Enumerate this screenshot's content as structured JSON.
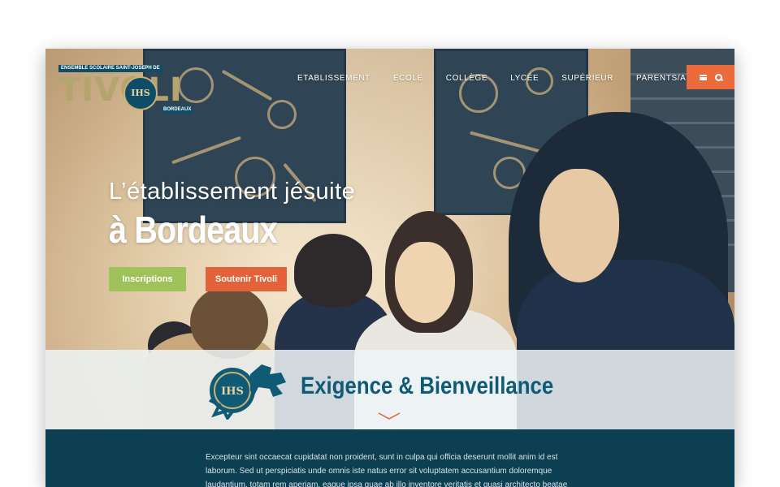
{
  "logo": {
    "top_text": "ENSEMBLE SCOLAIRE SAINT-JOSEPH DE",
    "word": "TIVOLI",
    "seal_text": "IHS",
    "city": "BORDEAUX"
  },
  "nav": {
    "items": [
      "ETABLISSEMENT",
      "ECOLE",
      "COLLÈGE",
      "LYCÉE",
      "SUPÉRIEUR",
      "PARENTS/APEL"
    ],
    "menu_icon": "hamburger-icon",
    "search_icon": "search-icon"
  },
  "hero": {
    "line1": "L’établissement jésuite",
    "line2": "à Bordeaux",
    "button_inscriptions": "Inscriptions",
    "button_soutenir": "Soutenir Tivoli"
  },
  "band": {
    "title": "Exigence & Bienveillance"
  },
  "body": {
    "paragraph": "Excepteur sint occaecat cupidatat non proident, sunt in culpa qui officia deserunt mollit anim id est laborum. Sed ut perspiciatis unde omnis iste natus error sit voluptatem accusantium doloremque laudantium, totam rem aperiam, eaque ipsa quae ab illo inventore veritatis et quasi architecto beatae vitae"
  },
  "colors": {
    "accent_orange": "#ec6b3d",
    "accent_green": "#9fc35a",
    "brand_blue": "#0f5b76",
    "dark_teal": "#0c3f52"
  }
}
